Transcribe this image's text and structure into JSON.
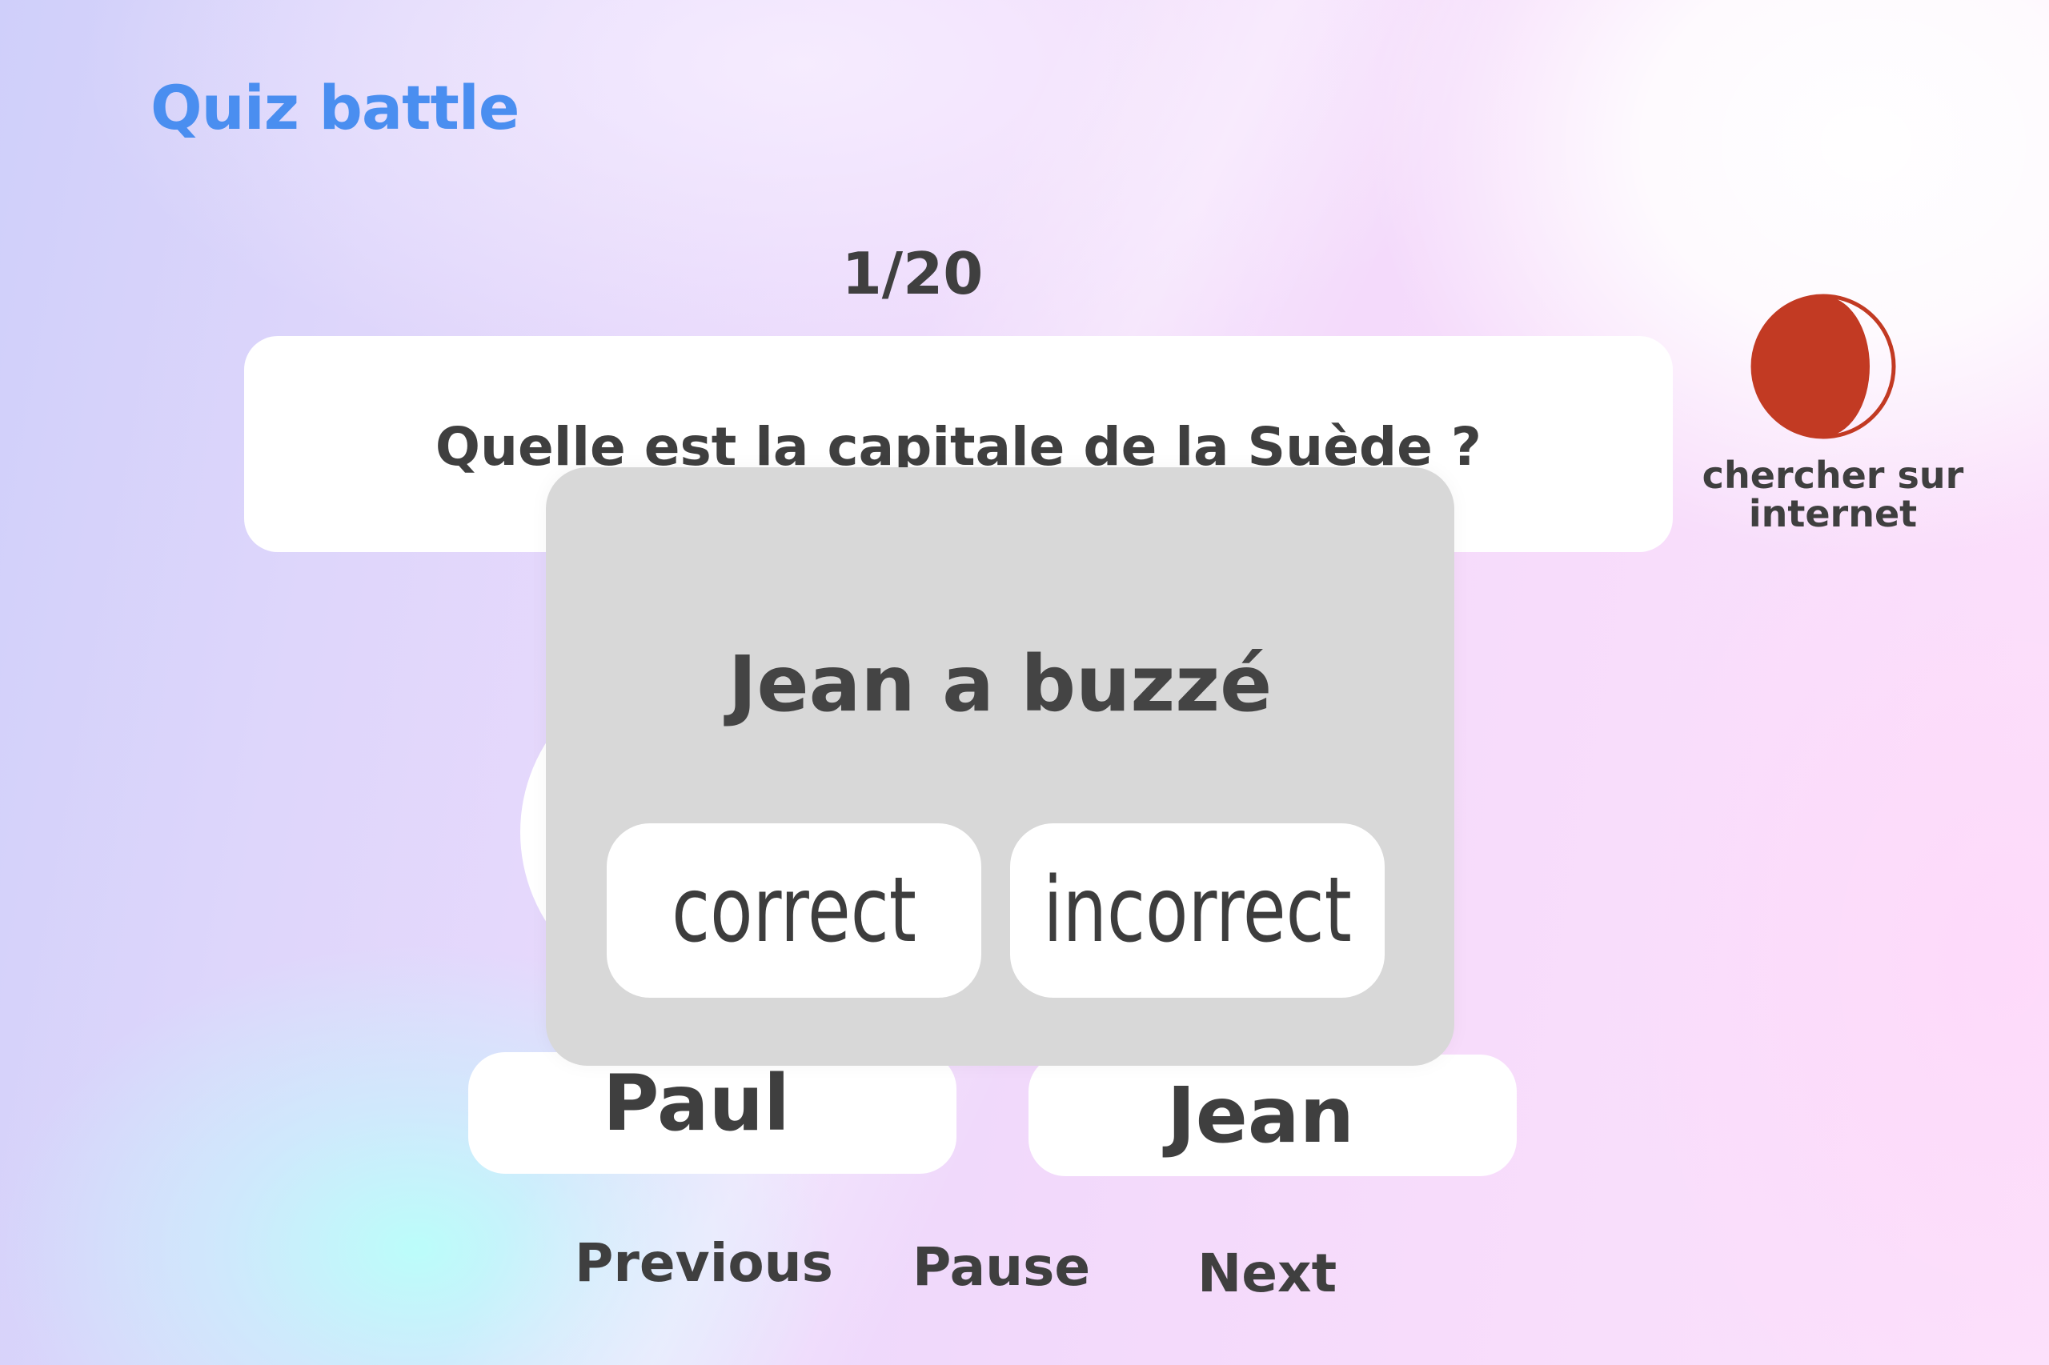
{
  "app": {
    "title": "Quiz battle"
  },
  "quiz": {
    "counter": "1/20",
    "question": "Quelle est la capitale de la Suède ?"
  },
  "search": {
    "label": "chercher sur internet",
    "icon": "moon-icon",
    "icon_color": "#c23a23"
  },
  "players": [
    {
      "name": "Paul"
    },
    {
      "name": "Jean"
    }
  ],
  "modal": {
    "title": "Jean a buzzé",
    "correct_label": "correct",
    "incorrect_label": "incorrect"
  },
  "controls": {
    "previous_label": "Previous",
    "pause_label": "Pause",
    "next_label": "Next"
  },
  "colors": {
    "accent": "#4a8ef0",
    "text": "#3f3f3f",
    "modal_bg": "#d8d8d8",
    "search_icon": "#c23a23"
  }
}
